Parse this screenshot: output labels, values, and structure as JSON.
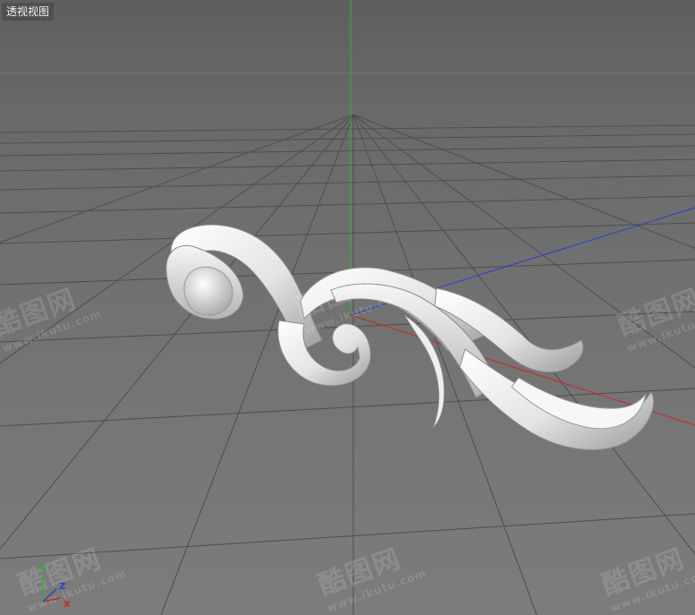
{
  "viewport": {
    "label": "透视视图",
    "axis_colors": {
      "x": "#c82828",
      "y": "#2fb52f",
      "z": "#2b3fd0"
    },
    "grid_color": "#4a4a4a",
    "object_color": "#eaeaea"
  },
  "gizmo": {
    "x_label": "X",
    "y_label": "Y",
    "z_label": "Z"
  },
  "watermark": {
    "brand": "酷图网",
    "url": "www.ikutu.com"
  }
}
